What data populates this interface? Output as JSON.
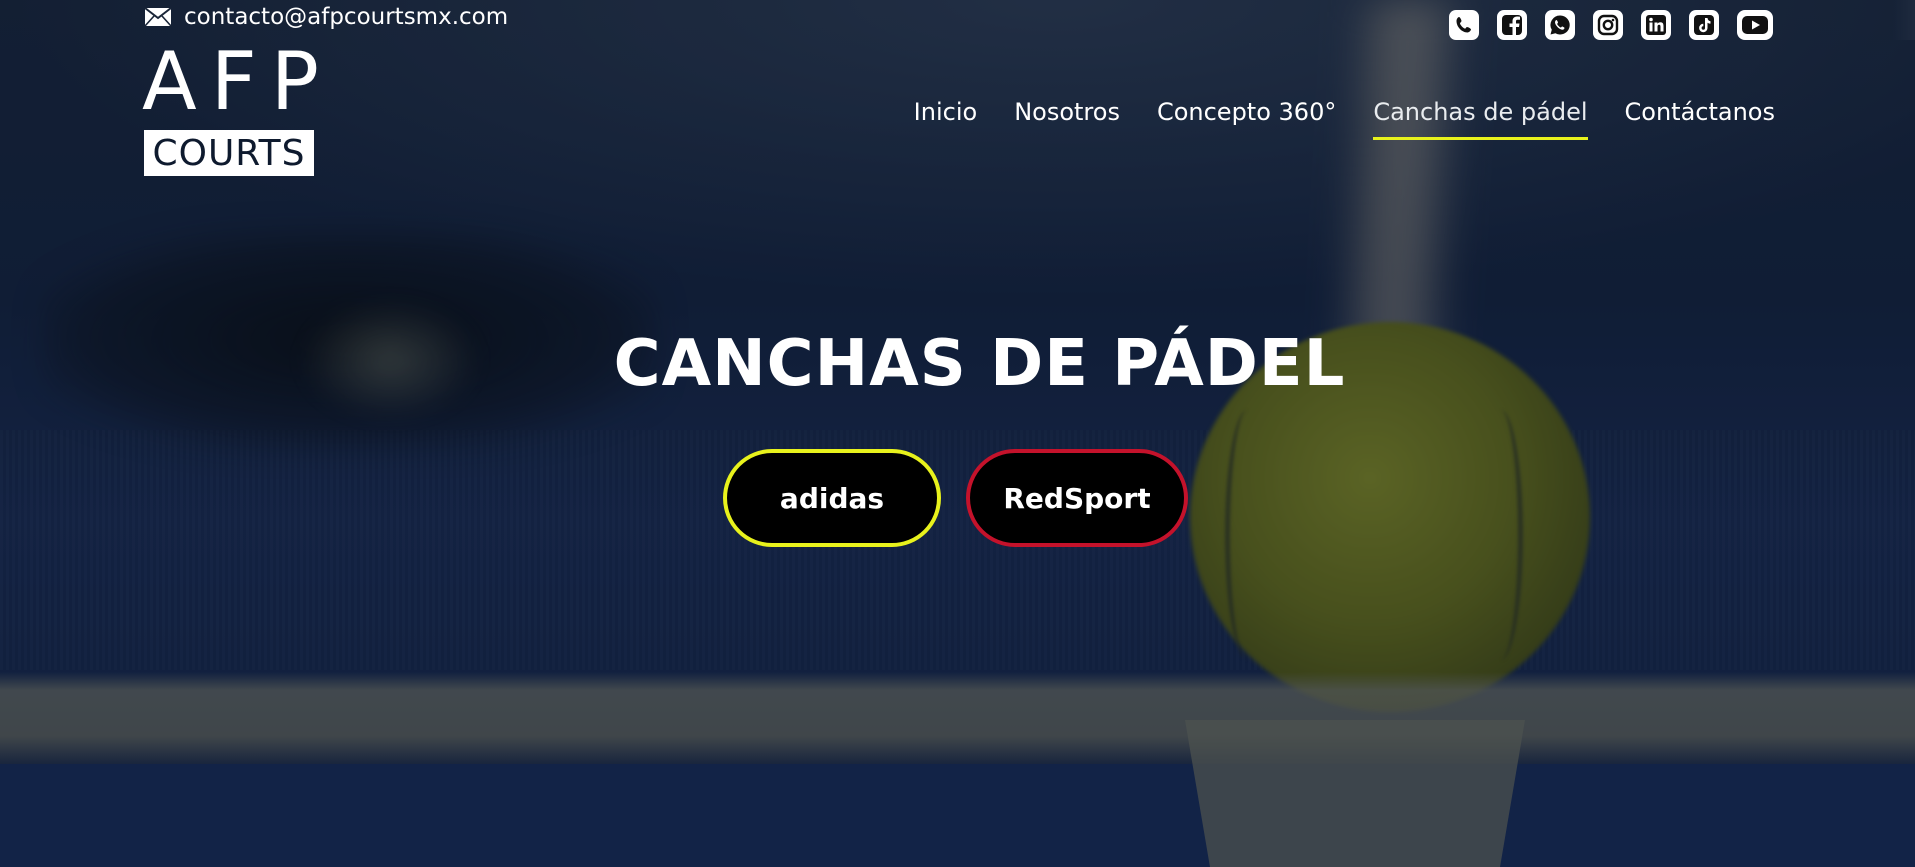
{
  "header": {
    "email": "contacto@afpcourtsmx.com",
    "email_icon": "mail-icon",
    "social": [
      {
        "name": "phone-icon"
      },
      {
        "name": "facebook-icon"
      },
      {
        "name": "whatsapp-icon"
      },
      {
        "name": "instagram-icon"
      },
      {
        "name": "linkedin-icon"
      },
      {
        "name": "tiktok-icon"
      },
      {
        "name": "youtube-icon"
      }
    ]
  },
  "logo": {
    "top": "AFP",
    "bottom": "COURTS"
  },
  "nav": {
    "items": [
      "Inicio",
      "Nosotros",
      "Concepto 360°",
      "Canchas de pádel",
      "Contáctanos"
    ],
    "active": "Canchas de pádel",
    "active_underline_color": "#e8f21c"
  },
  "hero": {
    "title": "CANCHAS DE PÁDEL",
    "buttons": [
      {
        "label": "adidas",
        "border_color": "#e8f21c"
      },
      {
        "label": "RedSport",
        "border_color": "#c4122b"
      }
    ]
  }
}
